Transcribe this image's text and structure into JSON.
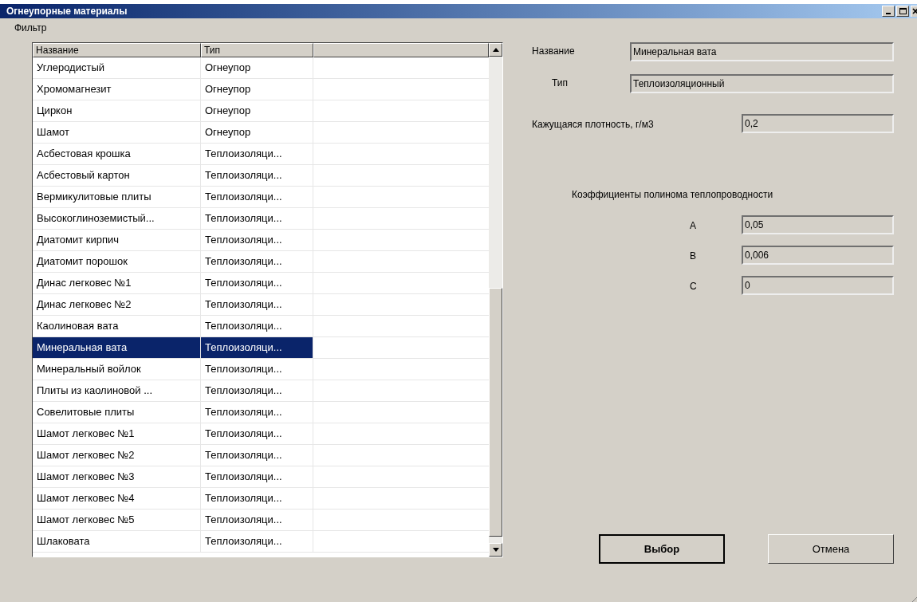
{
  "window": {
    "title": "Огнеупорные материалы"
  },
  "menu": [
    "Фильтр"
  ],
  "table": {
    "columns": [
      "Название",
      "Тип"
    ],
    "rows": [
      {
        "name": "Углеродистый",
        "type": "Огнеупор",
        "selected": false
      },
      {
        "name": "Хромомагнезит",
        "type": "Огнеупор",
        "selected": false
      },
      {
        "name": "Циркон",
        "type": "Огнеупор",
        "selected": false
      },
      {
        "name": "Шамот",
        "type": "Огнеупор",
        "selected": false
      },
      {
        "name": "Асбестовая крошка",
        "type": "Теплоизоляци...",
        "selected": false
      },
      {
        "name": "Асбестовый картон",
        "type": "Теплоизоляци...",
        "selected": false
      },
      {
        "name": "Вермикулитовые плиты",
        "type": "Теплоизоляци...",
        "selected": false
      },
      {
        "name": "Высокоглиноземистый...",
        "type": "Теплоизоляци...",
        "selected": false
      },
      {
        "name": "Диатомит кирпич",
        "type": "Теплоизоляци...",
        "selected": false
      },
      {
        "name": "Диатомит порошок",
        "type": "Теплоизоляци...",
        "selected": false
      },
      {
        "name": "Динас легковес №1",
        "type": "Теплоизоляци...",
        "selected": false
      },
      {
        "name": "Динас легковес №2",
        "type": "Теплоизоляци...",
        "selected": false
      },
      {
        "name": "Каолиновая вата",
        "type": "Теплоизоляци...",
        "selected": false
      },
      {
        "name": "Минеральная вата",
        "type": "Теплоизоляци...",
        "selected": true
      },
      {
        "name": "Минеральный войлок",
        "type": "Теплоизоляци...",
        "selected": false
      },
      {
        "name": "Плиты из каолиновой ...",
        "type": "Теплоизоляци...",
        "selected": false
      },
      {
        "name": "Совелитовые плиты",
        "type": "Теплоизоляци...",
        "selected": false
      },
      {
        "name": "Шамот легковес №1",
        "type": "Теплоизоляци...",
        "selected": false
      },
      {
        "name": "Шамот легковес №2",
        "type": "Теплоизоляци...",
        "selected": false
      },
      {
        "name": "Шамот легковес №3",
        "type": "Теплоизоляци...",
        "selected": false
      },
      {
        "name": "Шамот легковес №4",
        "type": "Теплоизоляци...",
        "selected": false
      },
      {
        "name": "Шамот легковес №5",
        "type": "Теплоизоляци...",
        "selected": false
      },
      {
        "name": "Шлаковата",
        "type": "Теплоизоляци...",
        "selected": false
      }
    ]
  },
  "details": {
    "name": {
      "label": "Название",
      "value": "Минеральная вата"
    },
    "type": {
      "label": "Тип",
      "value": "Теплоизоляционный"
    },
    "density": {
      "label": "Кажущаяся плотность, г/м3",
      "value": "0,2"
    },
    "coefficients_heading": "Коэффициенты полинома теплопроводности",
    "coefficients": [
      {
        "label": "A",
        "value": "0,05"
      },
      {
        "label": "B",
        "value": "0,006"
      },
      {
        "label": "C",
        "value": "0"
      }
    ]
  },
  "buttons": [
    {
      "label": "Выбор",
      "default": true
    },
    {
      "label": "Отмена",
      "default": false
    }
  ]
}
